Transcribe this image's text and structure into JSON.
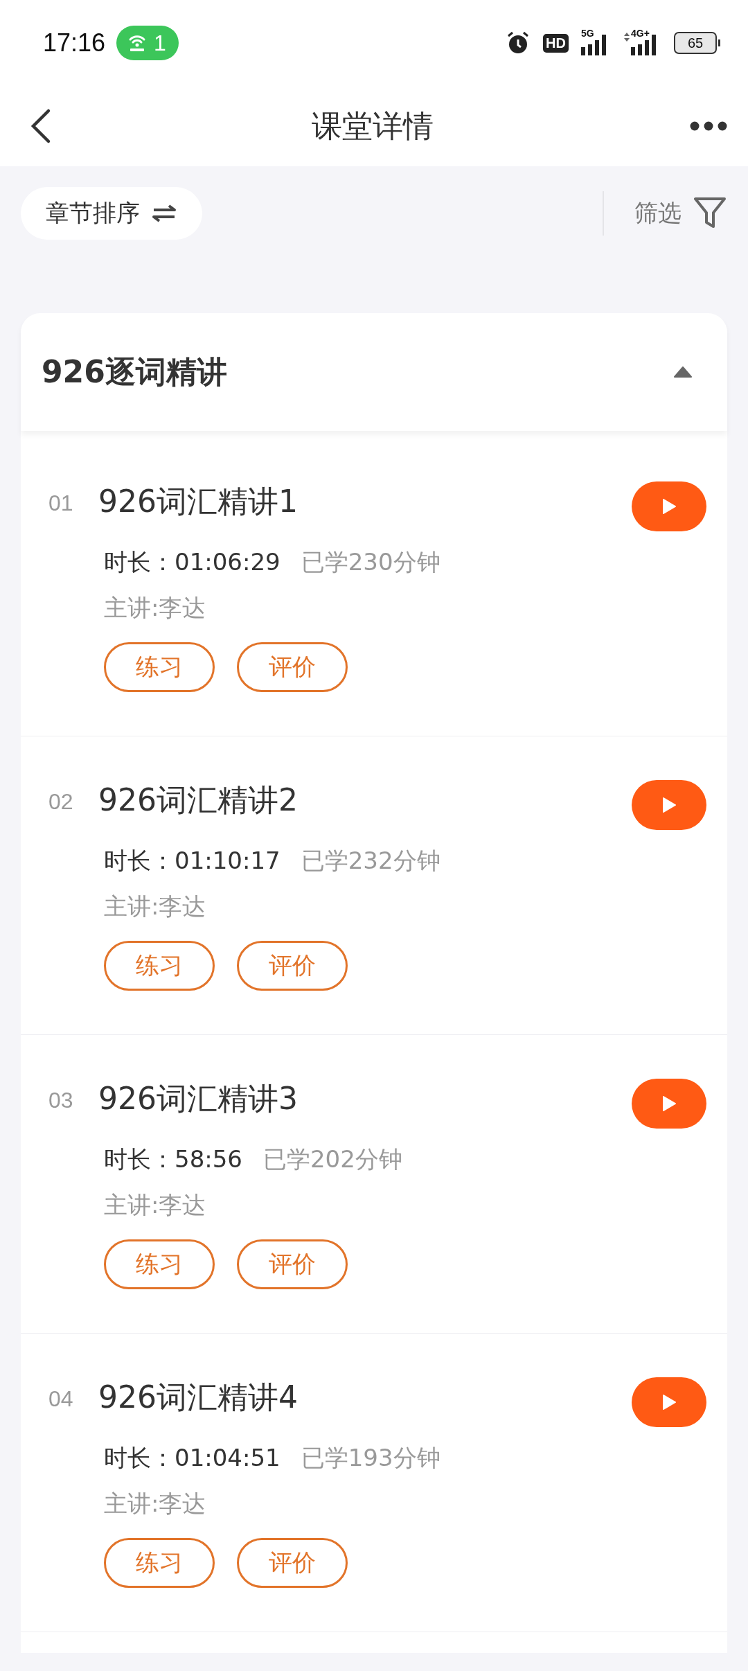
{
  "status_bar": {
    "time": "17:16",
    "hotspot_count": "1",
    "hd_label": "HD",
    "network_5g": "5G",
    "network_4g": "4G+",
    "battery": "65"
  },
  "header": {
    "title": "课堂详情"
  },
  "toolbar": {
    "sort_label": "章节排序",
    "filter_label": "筛选"
  },
  "section": {
    "title": "926逐词精讲",
    "expanded": true,
    "lessons": [
      {
        "number": "01",
        "title": "926词汇精讲1",
        "duration_label": "时长：",
        "duration": "01:06:29",
        "studied": "已学230分钟",
        "teacher": "主讲:李达",
        "buttons": [
          "练习",
          "评价"
        ]
      },
      {
        "number": "02",
        "title": "926词汇精讲2",
        "duration_label": "时长：",
        "duration": "01:10:17",
        "studied": "已学232分钟",
        "teacher": "主讲:李达",
        "buttons": [
          "练习",
          "评价"
        ]
      },
      {
        "number": "03",
        "title": "926词汇精讲3",
        "duration_label": "时长：",
        "duration": "58:56",
        "studied": "已学202分钟",
        "teacher": "主讲:李达",
        "buttons": [
          "练习",
          "评价"
        ]
      },
      {
        "number": "04",
        "title": "926词汇精讲4",
        "duration_label": "时长：",
        "duration": "01:04:51",
        "studied": "已学193分钟",
        "teacher": "主讲:李达",
        "buttons": [
          "练习",
          "评价"
        ]
      }
    ]
  }
}
